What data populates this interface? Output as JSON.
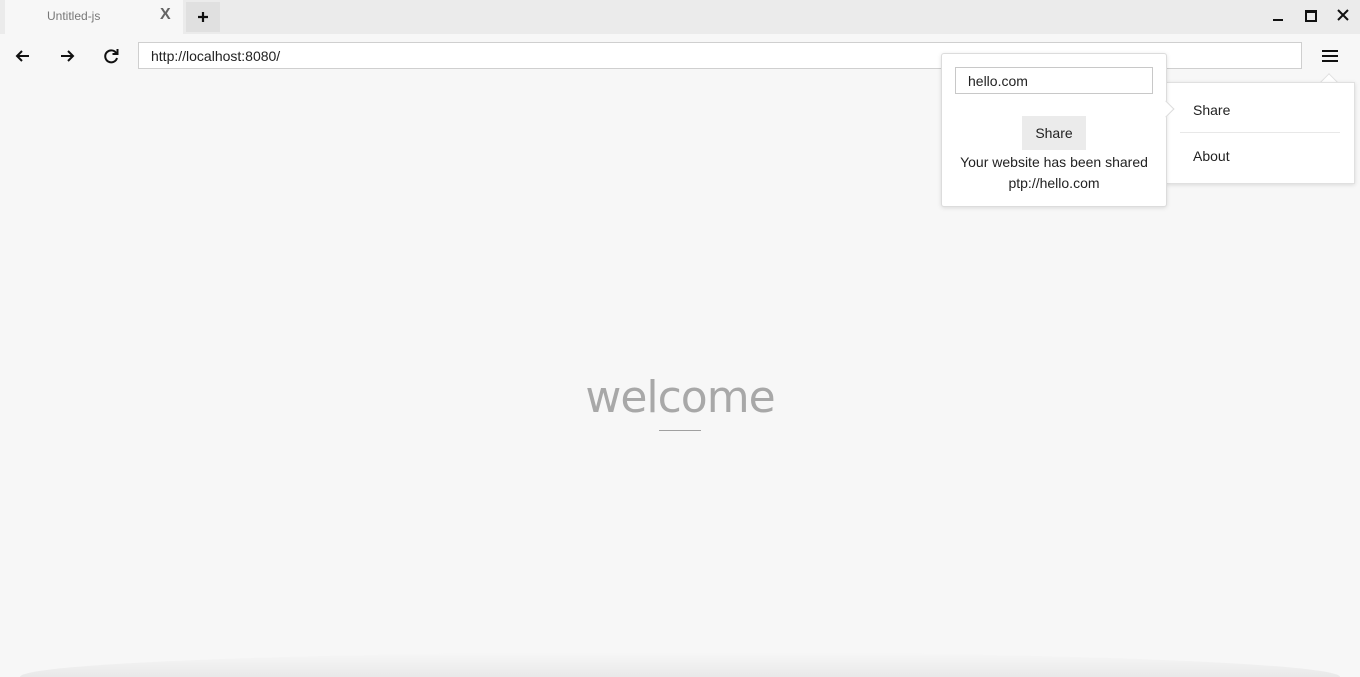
{
  "tab": {
    "title": "Untitled-js",
    "close_label": "X"
  },
  "toolbar": {
    "url": "http://localhost:8080/"
  },
  "page": {
    "welcome": "welcome"
  },
  "menu": {
    "items": [
      {
        "label": "Share"
      },
      {
        "label": "About"
      }
    ]
  },
  "share_popover": {
    "input_value": "hello.com",
    "button_label": "Share",
    "message_line1": "Your website has been shared",
    "message_line2": "ptp://hello.com"
  },
  "icons": {
    "new_tab": "plus-icon",
    "minimize": "minimize-icon",
    "maximize": "maximize-icon",
    "close_window": "close-icon",
    "back": "arrow-left-icon",
    "forward": "arrow-right-icon",
    "reload": "reload-icon",
    "menu": "hamburger-icon"
  }
}
